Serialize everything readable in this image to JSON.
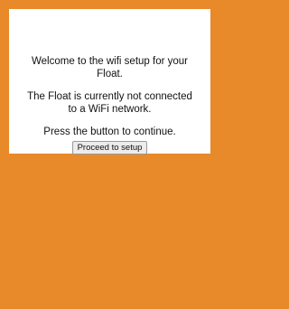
{
  "setup": {
    "welcome_text": "Welcome to the wifi setup for your Float.",
    "status_text": "The Float is currently not connected to a WiFi network.",
    "instruction_text": "Press the button to continue.",
    "proceed_button_label": "Proceed to setup"
  },
  "colors": {
    "background": "#e8892a",
    "card": "#ffffff"
  }
}
